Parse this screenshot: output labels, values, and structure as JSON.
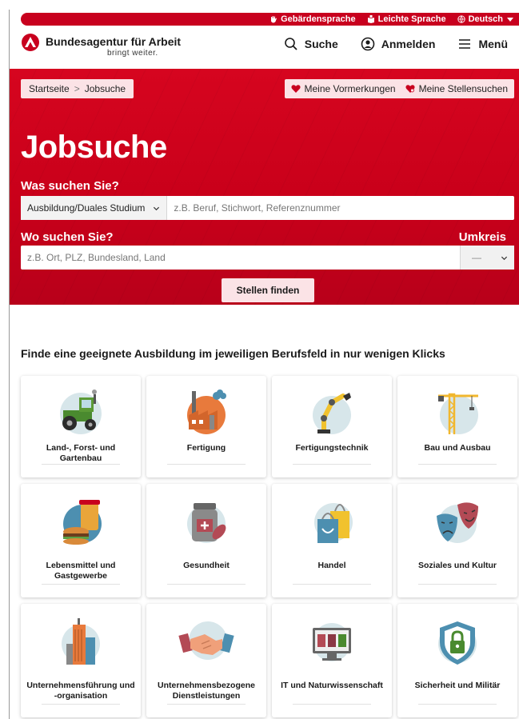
{
  "utility": {
    "sign_language": "Gebärdensprache",
    "easy_language": "Leichte Sprache",
    "language": "Deutsch"
  },
  "header": {
    "logo_title": "Bundesagentur für Arbeit",
    "logo_subtitle": "bringt weiter.",
    "search": "Suche",
    "login": "Anmelden",
    "menu": "Menü"
  },
  "breadcrumb": {
    "home": "Startseite",
    "separator": ">",
    "current": "Jobsuche"
  },
  "chips": {
    "bookmarks": "Meine Vormerkungen",
    "job_searches": "Meine Stellensuchen"
  },
  "search": {
    "title": "Jobsuche",
    "what_label": "Was suchen Sie?",
    "type_selected": "Ausbildung/Duales Studium",
    "what_placeholder": "z.B. Beruf, Stichwort, Referenznummer",
    "where_label": "Wo suchen Sie?",
    "where_placeholder": "z.B. Ort, PLZ, Bundesland, Land",
    "radius_label": "Umkreis",
    "radius_value": "—",
    "submit": "Stellen finden"
  },
  "section": {
    "heading": "Finde eine geeignete Ausbildung im jeweiligen Berufsfeld in nur wenigen Klicks",
    "cards": [
      {
        "label": "Land-, Forst- und Gartenbau",
        "icon": "tractor-icon"
      },
      {
        "label": "Fertigung",
        "icon": "factory-icon"
      },
      {
        "label": "Fertigungstechnik",
        "icon": "robot-arm-icon"
      },
      {
        "label": "Bau und Ausbau",
        "icon": "crane-icon"
      },
      {
        "label": "Lebensmittel und Gastgewerbe",
        "icon": "food-icon"
      },
      {
        "label": "Gesundheit",
        "icon": "medicine-icon"
      },
      {
        "label": "Handel",
        "icon": "shopping-bag-icon"
      },
      {
        "label": "Soziales und Kultur",
        "icon": "theater-masks-icon"
      },
      {
        "label": "Unternehmensführung und -organisation",
        "icon": "skyscraper-icon"
      },
      {
        "label": "Unternehmensbezogene Dienstleistungen",
        "icon": "handshake-icon"
      },
      {
        "label": "IT und Naturwissenschaft",
        "icon": "monitor-icon"
      },
      {
        "label": "Sicherheit und Militär",
        "icon": "shield-lock-icon"
      }
    ]
  },
  "colors": {
    "brand_red": "#c8001e",
    "chip_bg": "#fbe3e6"
  }
}
